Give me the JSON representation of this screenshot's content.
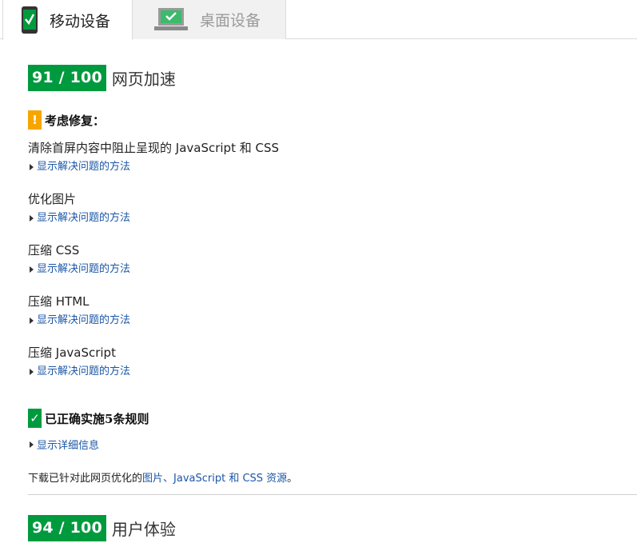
{
  "tabs": [
    {
      "label": "移动设备",
      "icon": "phone-icon",
      "active": true
    },
    {
      "label": "桌面设备",
      "icon": "laptop-icon",
      "active": false
    }
  ],
  "speed": {
    "score": "91 / 100",
    "title": "网页加速",
    "consider_label": "考虑修复：",
    "warn_icon_glyph": "!",
    "rules": [
      {
        "title": "清除首屏内容中阻止呈现的 JavaScript 和 CSS",
        "link": "显示解决问题的方法"
      },
      {
        "title": "优化图片",
        "link": "显示解决问题的方法"
      },
      {
        "title": "压缩 CSS",
        "link": "显示解决问题的方法"
      },
      {
        "title": "压缩 HTML",
        "link": "显示解决问题的方法"
      },
      {
        "title": "压缩 JavaScript",
        "link": "显示解决问题的方法"
      }
    ],
    "passed_label": "已正确实施5条规则",
    "check_icon_glyph": "✓",
    "details_link": "显示详细信息",
    "download": {
      "prefix": "下载已针对此网页优化的",
      "link": "图片、JavaScript 和 CSS 资源",
      "suffix": "。"
    }
  },
  "ux": {
    "score": "94 / 100",
    "title": "用户体验"
  },
  "colors": {
    "good": "#009a3e",
    "warning": "#f7a600",
    "link": "#1a56a6"
  }
}
